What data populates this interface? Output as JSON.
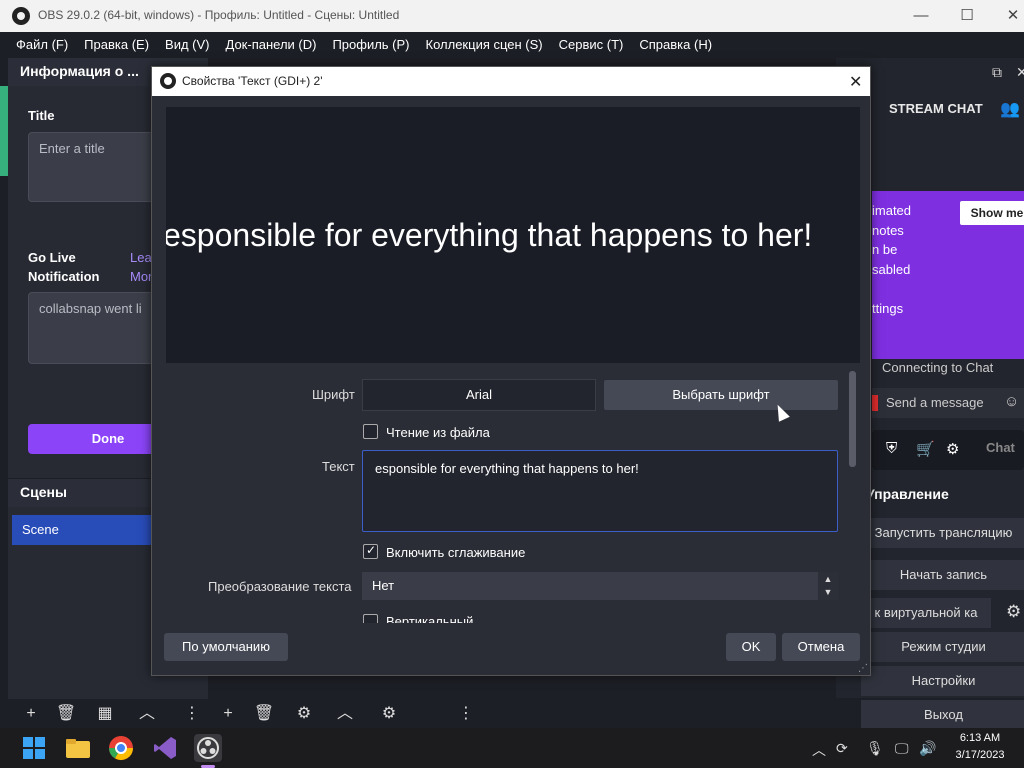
{
  "window": {
    "title": "OBS 29.0.2 (64-bit, windows) - Профиль: Untitled - Сцены: Untitled",
    "min": "—",
    "max": "☐",
    "close": "✕"
  },
  "menu": [
    "Файл (F)",
    "Правка (E)",
    "Вид (V)",
    "Док-панели (D)",
    "Профиль (P)",
    "Коллекция сцен (S)",
    "Сервис (T)",
    "Справка (H)"
  ],
  "info_dock": {
    "title": "Информация о ...",
    "title_label": "Title",
    "title_placeholder": "Enter a title",
    "golive_label_1": "Go Live",
    "golive_label_2": "Notification",
    "link_1": "Lea",
    "link_2": "Mor",
    "notification_value": "collabsnap went li",
    "done": "Done"
  },
  "scenes_dock": {
    "title": "Сцены",
    "items": [
      "Scene"
    ]
  },
  "right_dock": {
    "stream_chat": "STREAM CHAT",
    "banner_lines": [
      "imated",
      "notes",
      "n be",
      "sabled",
      "",
      "ttings"
    ],
    "show_me": "Show me",
    "connecting": "Connecting to Chat",
    "send_message": "Send a message",
    "chat_button": "Chat",
    "controls_title": "Управление",
    "controls": [
      "Запустить трансляцию",
      "Начать запись",
      "к виртуальной ка",
      "Режим студии",
      "Настройки",
      "Выход"
    ]
  },
  "dialog": {
    "title": "Свойства 'Текст (GDI+) 2'",
    "preview_text": "esponsible for everything that happens to her!",
    "font_label": "Шрифт",
    "font_value": "Arial",
    "pick_font": "Выбрать шрифт",
    "read_from_file": "Чтение из файла",
    "text_label": "Текст",
    "text_value": "esponsible for everything that happens to her!",
    "antialias": "Включить сглаживание",
    "transform_label": "Преобразование текста",
    "transform_value": "Нет",
    "vertical": "Вертикальный",
    "defaults": "По умолчанию",
    "ok": "OK",
    "cancel": "Отмена"
  },
  "taskbar": {
    "time": "6:13 AM",
    "date": "3/17/2023"
  },
  "colors": {
    "accent_purple": "#8b44f7",
    "scene_selected": "#284cb8",
    "banner": "#7e2fe0"
  }
}
